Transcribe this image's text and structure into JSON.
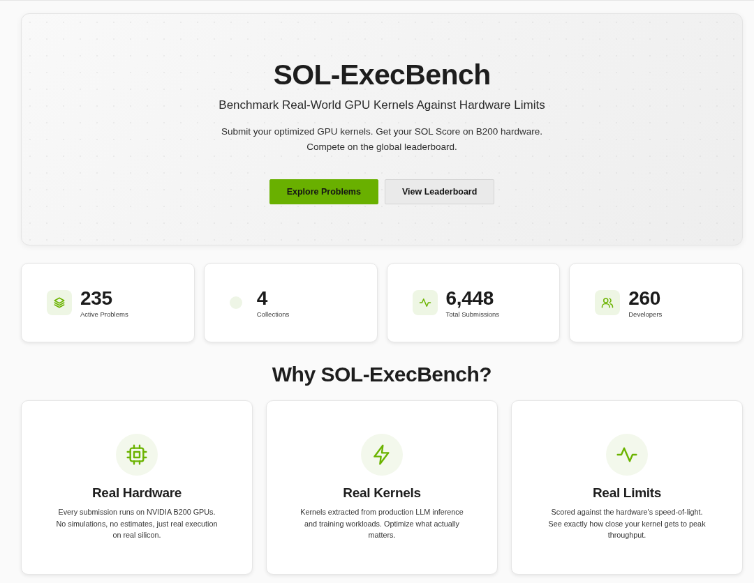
{
  "hero": {
    "title": "SOL-ExecBench",
    "subtitle": "Benchmark Real-World GPU Kernels Against Hardware Limits",
    "description": "Submit your optimized GPU kernels. Get your SOL Score on B200 hardware. Compete on the global leaderboard.",
    "buttons": [
      {
        "label": "Explore Problems",
        "kind": "primary"
      },
      {
        "label": "View Leaderboard",
        "kind": "secondary"
      }
    ]
  },
  "stats": [
    {
      "value": "235",
      "label": "Active Problems"
    },
    {
      "value": "4",
      "label": "Collections"
    },
    {
      "value": "6,448",
      "label": "Total Submissions"
    },
    {
      "value": "260",
      "label": "Developers"
    }
  ],
  "why": {
    "heading": "Why SOL-ExecBench?",
    "features": [
      {
        "title": "Real Hardware",
        "text": "Every submission runs on NVIDIA B200 GPUs. No simulations, no estimates, just real execution on real silicon."
      },
      {
        "title": "Real Kernels",
        "text": "Kernels extracted from production LLM inference and training workloads. Optimize what actually matters."
      },
      {
        "title": "Real Limits",
        "text": "Scored against the hardware's speed-of-light. See exactly how close your kernel gets to peak throughput."
      }
    ]
  }
}
